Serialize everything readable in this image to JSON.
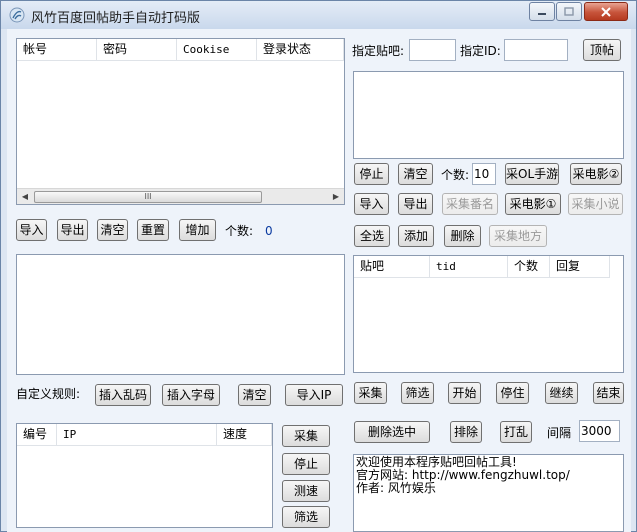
{
  "window": {
    "title": "风竹百度回帖助手自动打码版"
  },
  "account_table": {
    "columns": [
      "帐号",
      "密码",
      "Cookise",
      "登录状态"
    ],
    "scroll_thumb": "III"
  },
  "account_toolbar": {
    "import": "导入",
    "export": "导出",
    "clear": "清空",
    "reset": "重置",
    "add": "增加",
    "count_label": "个数:",
    "count_value": "0"
  },
  "rules": {
    "label": "自定义规则:",
    "insert_random": "插入乱码",
    "insert_char": "插入字母",
    "clear": "清空",
    "import_ip": "导入IP"
  },
  "proxy_table": {
    "columns": [
      "编号",
      "IP",
      "速度"
    ]
  },
  "proxy_buttons": {
    "collect": "采集",
    "stop": "停止",
    "speed_test": "测速",
    "filter": "筛选"
  },
  "target": {
    "bar_label": "指定贴吧:",
    "bar_value": "",
    "id_label": "指定ID:",
    "id_value": "",
    "top_button": "顶帖"
  },
  "collect_row1": {
    "stop": "停止",
    "clear": "清空",
    "count_label": "个数:",
    "count_value": "10",
    "ol_game": "采OL手游",
    "movie2": "采电影②"
  },
  "collect_row2": {
    "import": "导入",
    "export": "导出",
    "fan_name": "采集番名",
    "movie1": "采电影①",
    "novel": "采集小说"
  },
  "collect_row3": {
    "select_all": "全选",
    "add": "添加",
    "delete": "删除",
    "place": "采集地方"
  },
  "post_table": {
    "columns": [
      "贴吧",
      "tid",
      "个数",
      "回复"
    ]
  },
  "controls": {
    "collect": "采集",
    "filter": "筛选",
    "start": "开始",
    "pause": "停住",
    "resume": "继续",
    "end": "结束"
  },
  "controls2": {
    "delete_selected": "删除选中",
    "exclude": "排除",
    "shuffle": "打乱",
    "interval_label": "间隔",
    "interval_value": "3000"
  },
  "log": {
    "lines": [
      "欢迎使用本程序贴吧回帖工具!",
      "官方网站: http://www.fengzhuwl.top/",
      "作者: 风竹娱乐"
    ]
  },
  "colors": {
    "accent": "#0a3aa0",
    "close_button": "#c7543b"
  }
}
